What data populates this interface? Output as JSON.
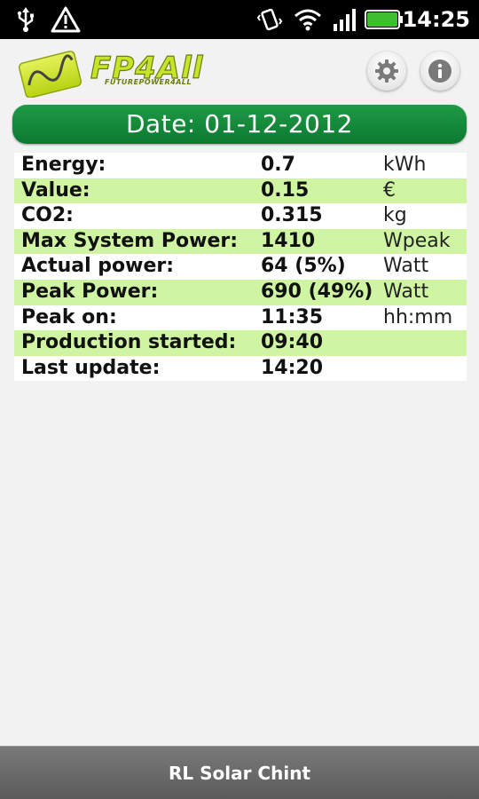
{
  "status_bar": {
    "time": "14:25",
    "icons": [
      "usb-icon",
      "warning-icon",
      "vibrate-icon",
      "wifi-icon",
      "signal-icon",
      "battery-icon"
    ],
    "battery_color": "#3fbf2f"
  },
  "header": {
    "logo_text": "FP4All",
    "logo_subtext": "FUTUREPOWER4ALL",
    "logo_color": "#c6e52a",
    "buttons": [
      "settings-icon",
      "info-icon"
    ]
  },
  "date_banner": {
    "text": "Date: 01-12-2012",
    "color": "#12893a"
  },
  "rows": [
    {
      "label": "Energy:",
      "value": "0.7",
      "unit": "kWh"
    },
    {
      "label": "Value:",
      "value": "0.15",
      "unit": "€"
    },
    {
      "label": "CO2:",
      "value": "0.315",
      "unit": "kg"
    },
    {
      "label": "Max System Power:",
      "value": "1410",
      "unit": "Wpeak"
    },
    {
      "label": "Actual power:",
      "value": "64 (5%)",
      "unit": "Watt"
    },
    {
      "label": "Peak Power:",
      "value": "690 (49%)",
      "unit": "Watt"
    },
    {
      "label": "Peak on:",
      "value": "11:35",
      "unit": "hh:mm"
    },
    {
      "label": "Production started:",
      "value": "09:40",
      "unit": ""
    },
    {
      "label": "Last update:",
      "value": "14:20",
      "unit": ""
    }
  ],
  "row_colors": {
    "even": "#ffffff",
    "odd": "#cff5a3"
  },
  "footer": {
    "title": "RL Solar Chint"
  }
}
